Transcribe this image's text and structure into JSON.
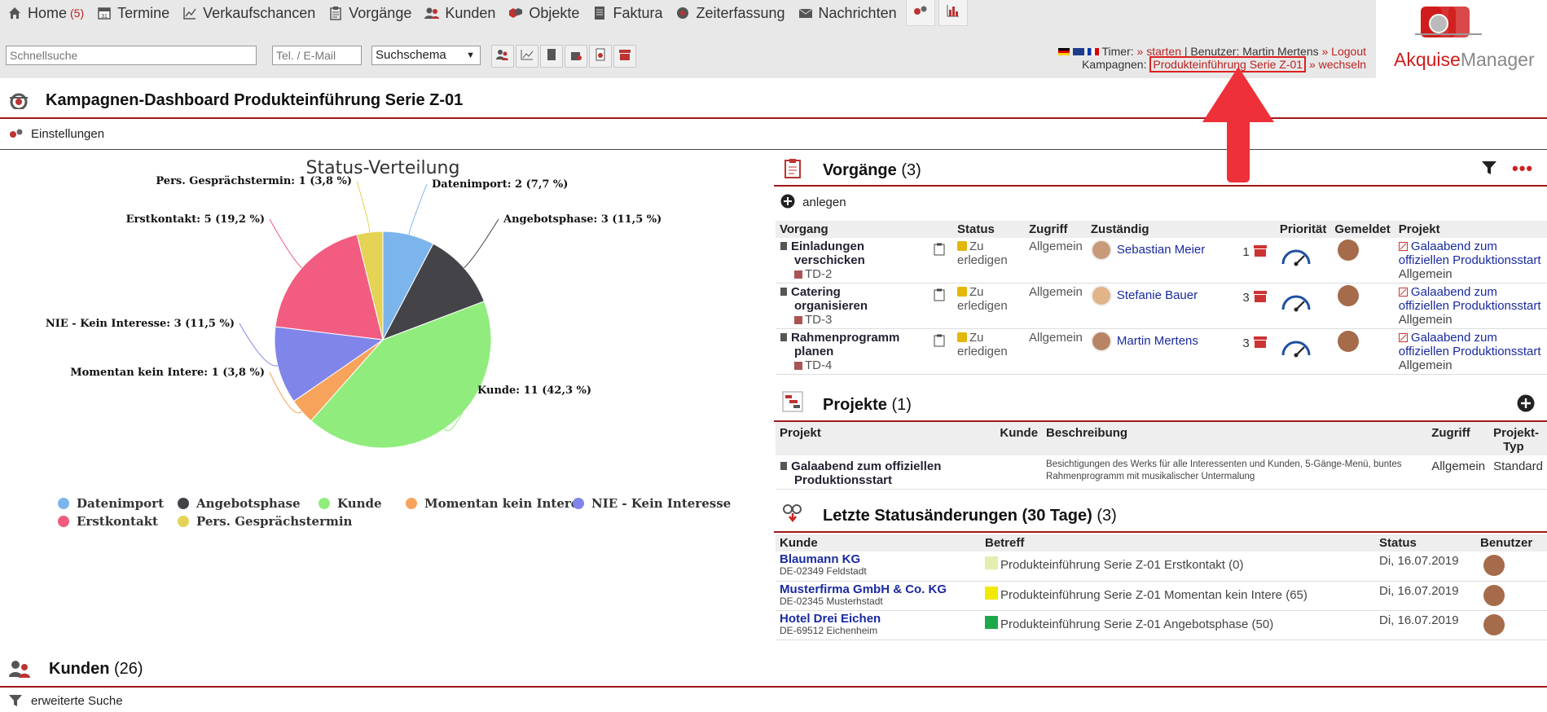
{
  "nav": {
    "items": [
      {
        "label": "Home",
        "count": "(5)",
        "icon": "home-icon"
      },
      {
        "label": "Termine",
        "icon": "calendar-icon"
      },
      {
        "label": "Verkaufschancen",
        "icon": "chart-line-icon"
      },
      {
        "label": "Vorgänge",
        "icon": "clipboard-icon"
      },
      {
        "label": "Kunden",
        "icon": "users-icon"
      },
      {
        "label": "Objekte",
        "icon": "objects-icon"
      },
      {
        "label": "Faktura",
        "icon": "invoice-icon"
      },
      {
        "label": "Zeiterfassung",
        "icon": "clock-gear-icon"
      },
      {
        "label": "Nachrichten",
        "icon": "envelope-icon"
      }
    ]
  },
  "search": {
    "quick_placeholder": "Schnellsuche",
    "phone_placeholder": "Tel. / E-Mail",
    "schema_value": "Suchschema"
  },
  "status": {
    "timer_label": "Timer:",
    "timer_start": "» starten",
    "user_label": "| Benutzer: Martin Mertens",
    "logout": "» Logout",
    "campaign_label": "Kampagnen:",
    "campaign_value": "Produkteinführung Serie Z-01",
    "switch": "» wechseln"
  },
  "logo": {
    "part1": "Akquise",
    "part2": "Manager"
  },
  "page": {
    "title": "Kampagnen-Dashboard Produkteinführung Serie Z-01",
    "settings": "Einstellungen"
  },
  "chart_data": {
    "type": "pie",
    "title": "Status-Verteilung",
    "slices": [
      {
        "label": "Datenimport",
        "value": 2,
        "percent": 7.7,
        "color": "#7cb5ec",
        "text": "Datenimport: 2 (7,7 %)"
      },
      {
        "label": "Angebotsphase",
        "value": 3,
        "percent": 11.5,
        "color": "#434348",
        "text": "Angebotsphase: 3 (11,5 %)"
      },
      {
        "label": "Kunde",
        "value": 11,
        "percent": 42.3,
        "color": "#90ed7d",
        "text": "Kunde: 11 (42,3 %)"
      },
      {
        "label": "Momentan kein Intere",
        "value": 1,
        "percent": 3.8,
        "color": "#f7a35c",
        "text": "Momentan kein Intere: 1 (3,8 %)"
      },
      {
        "label": "NIE - Kein Interesse",
        "value": 3,
        "percent": 11.5,
        "color": "#8085e9",
        "text": "NIE - Kein Interesse: 3 (11,5 %)"
      },
      {
        "label": "Erstkontakt",
        "value": 5,
        "percent": 19.2,
        "color": "#f15c80",
        "text": "Erstkontakt: 5 (19,2 %)"
      },
      {
        "label": "Pers. Gesprächstermin",
        "value": 1,
        "percent": 3.8,
        "color": "#e4d354",
        "text": "Pers. Gesprächstermin: 1 (3,8 %)"
      }
    ],
    "legend": "bottom"
  },
  "vorgaenge": {
    "title": "Vorgänge",
    "count": "(3)",
    "create": "anlegen",
    "columns": [
      "Vorgang",
      "Status",
      "Zugriff",
      "Zuständig",
      "Priorität",
      "Gemeldet",
      "Projekt"
    ],
    "rows": [
      {
        "name1": "Einladungen",
        "name2": "verschicken",
        "id": "TD-2",
        "status1": "Zu",
        "status2": "erledigen",
        "zugriff": "Allgemein",
        "person": "Sebastian Meier",
        "num": "1",
        "proj1": "Galaabend zum",
        "proj2": "offiziellen Produktionsstart",
        "proj3": "Allgemein"
      },
      {
        "name1": "Catering",
        "name2": "organisieren",
        "id": "TD-3",
        "status1": "Zu",
        "status2": "erledigen",
        "zugriff": "Allgemein",
        "person": "Stefanie Bauer",
        "num": "3",
        "proj1": "Galaabend zum",
        "proj2": "offiziellen Produktionsstart",
        "proj3": "Allgemein"
      },
      {
        "name1": "Rahmenprogramm",
        "name2": "planen",
        "id": "TD-4",
        "status1": "Zu",
        "status2": "erledigen",
        "zugriff": "Allgemein",
        "person": "Martin Mertens",
        "num": "3",
        "proj1": "Galaabend zum",
        "proj2": "offiziellen Produktionsstart",
        "proj3": "Allgemein"
      }
    ]
  },
  "projekte": {
    "title": "Projekte",
    "count": "(1)",
    "columns": [
      "Projekt",
      "Kunde",
      "Beschreibung",
      "Zugriff",
      "Projekt-",
      "Typ"
    ],
    "rows": [
      {
        "name1": "Galaabend zum offiziellen",
        "name2": "Produktionsstart",
        "kunde": "",
        "desc1": "Besichtigungen des Werks für alle Interessenten und Kunden, 5-Gänge-Menü, buntes",
        "desc2": "Rahmenprogramm mit musikalischer Untermalung",
        "zugriff": "Allgemein",
        "typ": "Standard"
      }
    ]
  },
  "status_changes": {
    "title": "Letzte Statusänderungen (30 Tage)",
    "count": "(3)",
    "columns": [
      "Kunde",
      "Betreff",
      "Status",
      "Benutzer"
    ],
    "rows": [
      {
        "kunde": "Blaumann KG",
        "ort": "DE-02349 Feldstadt",
        "betreff": "Produkteinführung Serie Z-01 Erstkontakt (0)",
        "color": "#e6edb0",
        "date": "Di, 16.07.2019"
      },
      {
        "kunde": "Musterfirma GmbH & Co. KG",
        "ort": "DE-02345 Musterhstadt",
        "betreff": "Produkteinführung Serie Z-01 Momentan kein Intere (65)",
        "color": "#f1ea00",
        "date": "Di, 16.07.2019"
      },
      {
        "kunde": "Hotel Drei Eichen",
        "ort": "DE-69512 Eichenheim",
        "betreff": "Produkteinführung Serie Z-01 Angebotsphase (50)",
        "color": "#1fa84a",
        "date": "Di, 16.07.2019"
      }
    ]
  },
  "kunden": {
    "title": "Kunden",
    "count": "(26)",
    "search": "erweiterte Suche"
  }
}
